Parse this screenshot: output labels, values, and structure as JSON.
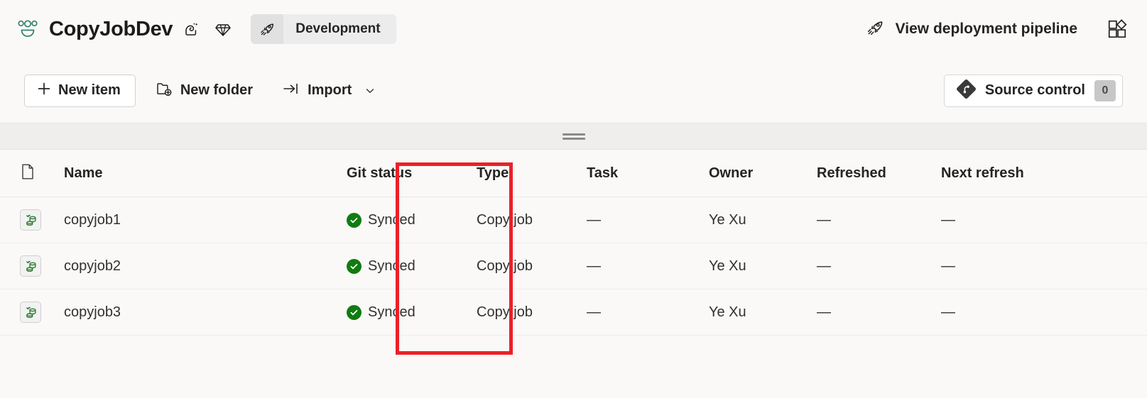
{
  "header": {
    "workspace_icon": "workspace-people-icon",
    "workspace_title": "CopyJobDev",
    "icons": [
      {
        "name": "copilot-sparkle-icon"
      },
      {
        "name": "diamond-gem-icon"
      }
    ],
    "environment": {
      "icon": "rocket-icon",
      "label": "Development"
    },
    "pipeline": {
      "icon": "rocket-icon",
      "label": "View deployment pipeline"
    },
    "apps_icon": "apps-grid-add-icon"
  },
  "toolbar": {
    "new_item": {
      "icon": "plus-icon",
      "label": "New item"
    },
    "new_folder": {
      "icon": "folder-add-icon",
      "label": "New folder"
    },
    "import": {
      "icon": "import-arrow-icon",
      "label": "Import",
      "chevron": "chevron-down-icon"
    },
    "source_control": {
      "icon": "git-logo-icon",
      "label": "Source control",
      "badge": "0"
    }
  },
  "splitter": {
    "handle": "drag-handle-icon"
  },
  "table": {
    "columns": {
      "icon": "document-icon",
      "name": "Name",
      "git_status": "Git status",
      "type": "Type",
      "task": "Task",
      "owner": "Owner",
      "refreshed": "Refreshed",
      "next_refresh": "Next refresh"
    },
    "rows": [
      {
        "icon": "copy-job-icon",
        "name": "copyjob1",
        "git_status": "Synced",
        "git_status_icon": "check-circle-icon",
        "type": "Copy job",
        "task": "—",
        "owner": "Ye Xu",
        "refreshed": "—",
        "next_refresh": "—"
      },
      {
        "icon": "copy-job-icon",
        "name": "copyjob2",
        "git_status": "Synced",
        "git_status_icon": "check-circle-icon",
        "type": "Copy job",
        "task": "—",
        "owner": "Ye Xu",
        "refreshed": "—",
        "next_refresh": "—"
      },
      {
        "icon": "copy-job-icon",
        "name": "copyjob3",
        "git_status": "Synced",
        "git_status_icon": "check-circle-icon",
        "type": "Copy job",
        "task": "—",
        "owner": "Ye Xu",
        "refreshed": "—",
        "next_refresh": "—"
      }
    ]
  },
  "annotation": {
    "name": "git-status-column-highlight",
    "color": "#ec2027"
  },
  "colors": {
    "page_background": "#faf9f8",
    "synced_green": "#107c10",
    "workspace_icon_green": "#31806b",
    "highlight_red": "#ec2027",
    "splitter_band": "#efeeed"
  }
}
